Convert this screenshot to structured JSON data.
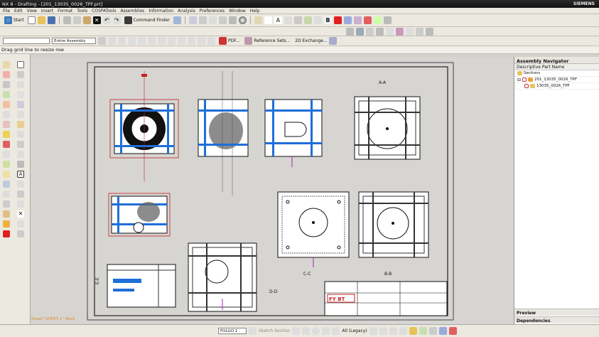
{
  "window": {
    "title": "NX 8 - Drafting - [201_13035_0026_TPF.prt]",
    "brand": "SIEMENS"
  },
  "menu": [
    "File",
    "Edit",
    "View",
    "Insert",
    "Format",
    "Tools",
    "COSPATools",
    "Assemblies",
    "Information",
    "Analysis",
    "Preferences",
    "Window",
    "Help"
  ],
  "toolbar": {
    "start_label": "Start",
    "command_finder_label": "Command Finder",
    "pdf_label": "PDF...",
    "reference_sets_label": "Reference Sets...",
    "exchange_label": "2D Exchange...",
    "filter_value": "",
    "assembly_filter_value": "Entire Assembly"
  },
  "status": {
    "message": "Drag grid line to resize row"
  },
  "navigator": {
    "title": "Assembly Navigator",
    "column_header": "Descriptive Part Name",
    "items": [
      {
        "label": "Sections",
        "level": 1
      },
      {
        "label": "201_13035_0026_TPF",
        "level": 1
      },
      {
        "label": "13035_0026_TPF",
        "level": 2
      }
    ],
    "preview_label": "Preview",
    "dependencies_label": "Dependencies"
  },
  "bottom": {
    "sheet_label": "Sheet \"SHEET 1\" Work",
    "layer_value": "FOLGO 1",
    "sketch_label": "Sketch Section",
    "style_label": "All (Legacy)"
  },
  "views": {
    "top_row": [
      "A-A"
    ],
    "middle": [
      "E-E"
    ],
    "section_labels": [
      "C-C",
      "B-B",
      "D-D"
    ]
  },
  "title_block": {
    "company": "FY BT"
  },
  "colors": {
    "accent_blue": "#1e6fd8",
    "dim_red": "#c81e1e",
    "sheet_bg": "#d6d5d2",
    "magenta": "#b020c0"
  }
}
